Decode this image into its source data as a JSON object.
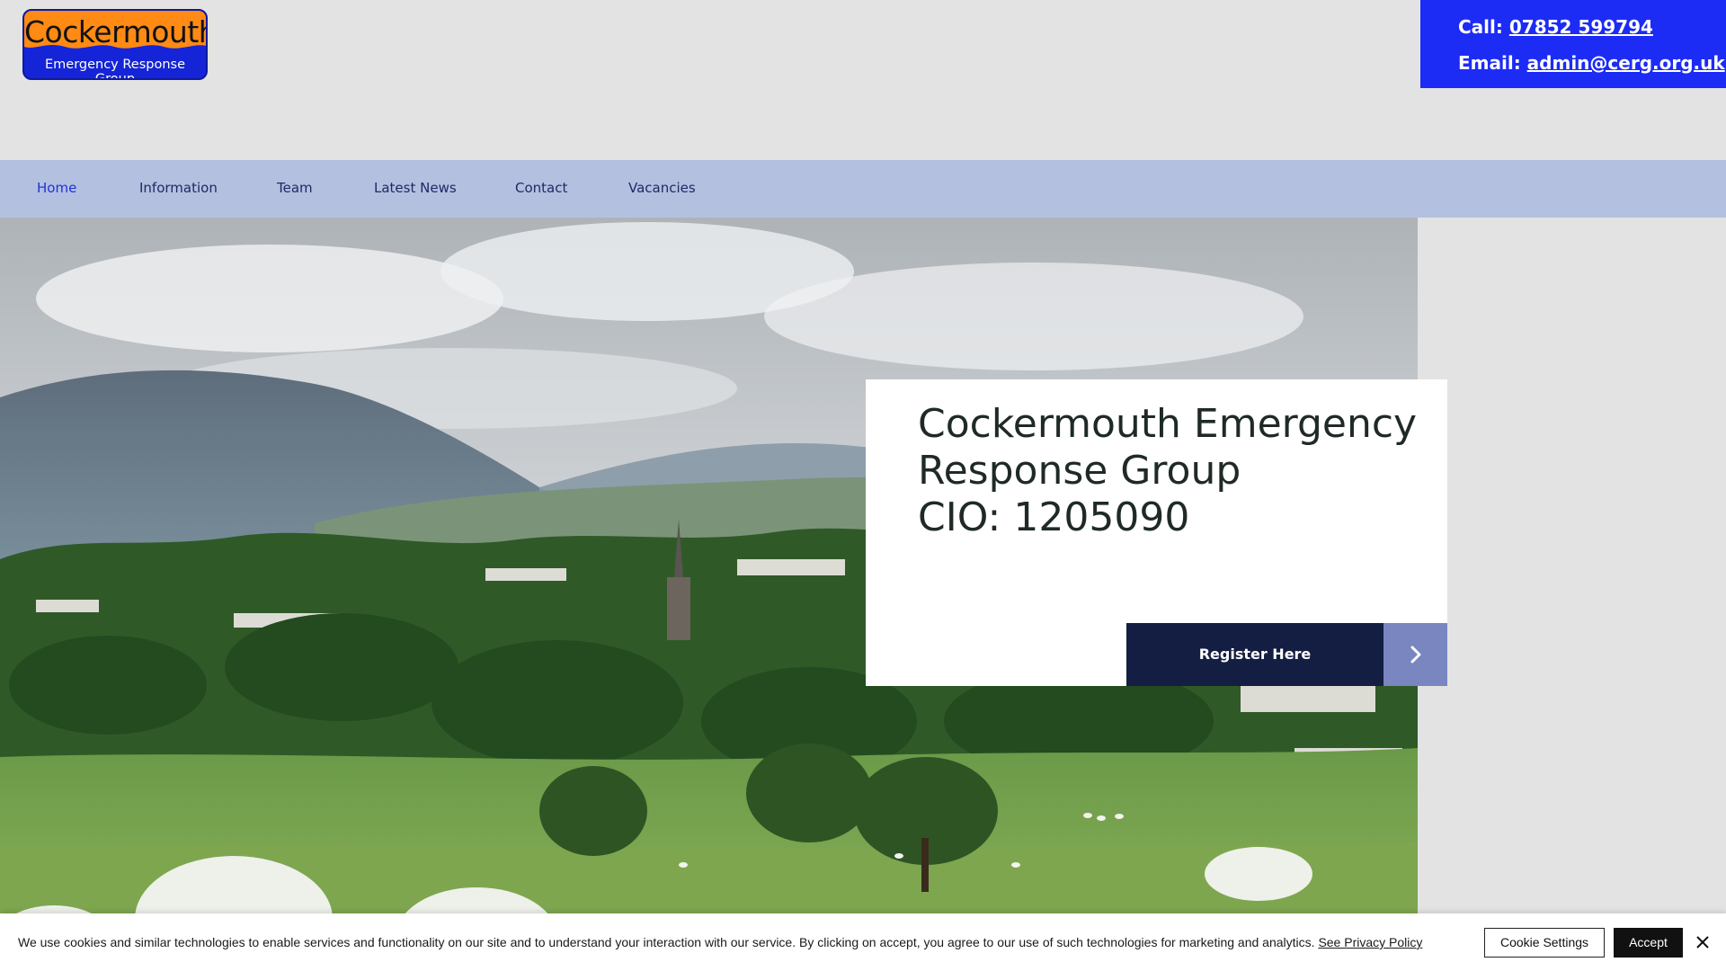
{
  "header": {
    "logo": {
      "title": "Cockermouth",
      "subtitle": "Emergency Response Group"
    },
    "contact": {
      "call_label": "Call: ",
      "phone": "07852 599794",
      "email_label": "Email: ",
      "email": "admin@cerg.org.uk"
    }
  },
  "nav": {
    "items": [
      {
        "label": "Home",
        "active": true
      },
      {
        "label": "Information"
      },
      {
        "label": "Team"
      },
      {
        "label": "Latest News"
      },
      {
        "label": "Contact"
      },
      {
        "label": "Vacancies"
      }
    ]
  },
  "hero": {
    "card": {
      "title_line1": "Cockermouth Emergency",
      "title_line2": "Response Group",
      "title_line3": "CIO: 1205090",
      "button_label": "Register Here"
    }
  },
  "cookie": {
    "text": "We use cookies and similar technologies to enable services and functionality on our site and to understand your interaction with our service. By clicking on accept, you agree to our use of such technologies for marketing and analytics. ",
    "privacy_link": "See Privacy Policy",
    "settings_label": "Cookie Settings",
    "accept_label": "Accept"
  },
  "colors": {
    "header_bg": "#e3e3e3",
    "contact_bg": "#1c2cf5",
    "nav_bg": "#b4c0e0",
    "nav_active": "#1e33d8",
    "button_dark": "#141e42",
    "button_arrow": "#7a86bf"
  }
}
